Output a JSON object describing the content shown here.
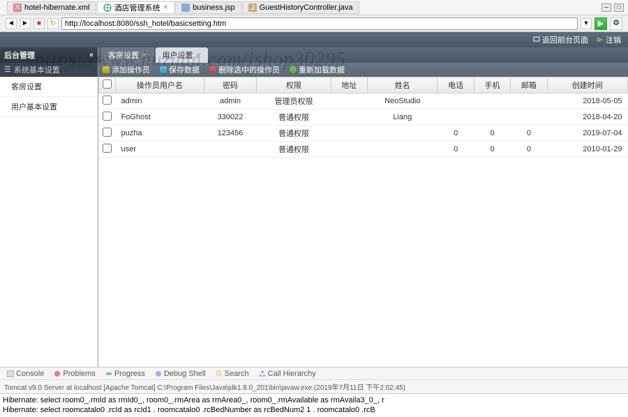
{
  "editorTabs": [
    {
      "icon": "xml",
      "label": "hotel-hibernate.xml",
      "active": false
    },
    {
      "icon": "web",
      "label": "酒店管理系统",
      "active": true
    },
    {
      "icon": "jsp",
      "label": "business.jsp",
      "active": false
    },
    {
      "icon": "java",
      "label": "GuestHistoryController.java",
      "active": false
    }
  ],
  "url": "http://localhost:8080/ssh_hotel/basicsetting.htm",
  "header": {
    "back": "返回前台页面",
    "logout": "注销"
  },
  "sidebar": {
    "title": "后台管理",
    "subtitle": "系统基本设置",
    "items": [
      "客房设置",
      "用户基本设置"
    ]
  },
  "contentTabs": [
    {
      "label": "客房设置",
      "active": false
    },
    {
      "label": "用户设置",
      "active": true
    }
  ],
  "toolbar": {
    "add": "添加操作员",
    "save": "保存数据",
    "del": "删除选中的操作员",
    "reload": "重新加载数据"
  },
  "columns": [
    "操作员用户名",
    "密码",
    "权限",
    "地址",
    "姓名",
    "电话",
    "手机",
    "邮箱",
    "创建时间"
  ],
  "rows": [
    {
      "user": "admin",
      "pwd": "admin",
      "perm": "管理员权限",
      "addr": "",
      "name": "NeoStudio",
      "tel": "",
      "mobile": "",
      "email": "",
      "created": "2018-05-05"
    },
    {
      "user": "FoGhost",
      "pwd": "330022",
      "perm": "普通权限",
      "addr": "",
      "name": "Liang",
      "tel": "",
      "mobile": "",
      "email": "",
      "created": "2018-04-20"
    },
    {
      "user": "puzha",
      "pwd": "123456",
      "perm": "普通权限",
      "addr": "",
      "name": "",
      "tel": "0",
      "mobile": "0",
      "email": "0",
      "created": "2019-07-04"
    },
    {
      "user": "user",
      "pwd": "",
      "perm": "普通权限",
      "addr": "",
      "name": "",
      "tel": "0",
      "mobile": "0",
      "email": "0",
      "created": "2010-01-29"
    }
  ],
  "bottomTabs": [
    "Console",
    "Problems",
    "Progress",
    "Debug Shell",
    "Search",
    "Call Hierarchy"
  ],
  "serverLine": "Tomcat v9.0 Server at localhost [Apache Tomcat] C:\\Program Files\\Java\\jdk1.8.0_201\\bin\\javaw.exe (2019年7月11日 下午2:02:45)",
  "consoleLines": [
    "Hibernate: select room0_.rmId as rmId0_, room0_.rmArea as rmArea0_, room0_.rmAvailable as rmAvaila3_0_, r",
    "Hibernate: select roomcatalo0 .rcId as rcId1 . roomcatalo0 .rcBedNumber as rcBedNum2 1 . roomcatalo0 .rcB"
  ],
  "watermark": "https://www.huzhan.com/ishop30295"
}
